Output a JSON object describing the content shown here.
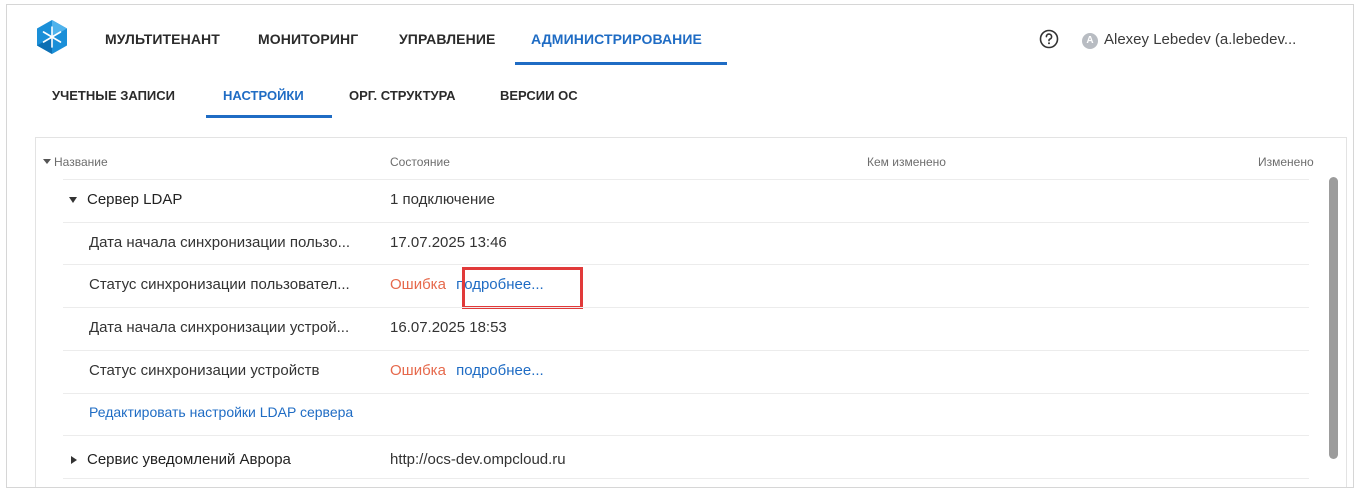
{
  "topnav": {
    "items": [
      {
        "label": "МУЛЬТИТЕНАНТ"
      },
      {
        "label": "МОНИТОРИНГ"
      },
      {
        "label": "УПРАВЛЕНИЕ"
      },
      {
        "label": "АДМИНИСТРИРОВАНИЕ"
      }
    ],
    "active_index": 3,
    "user": {
      "avatar_letter": "A",
      "name": "Alexey Lebedev (a.lebedev..."
    }
  },
  "subnav": {
    "items": [
      {
        "label": "УЧЕТНЫЕ ЗАПИСИ"
      },
      {
        "label": "НАСТРОЙКИ"
      },
      {
        "label": "ОРГ. СТРУКТУРА"
      },
      {
        "label": "ВЕРСИИ ОС"
      }
    ],
    "active_index": 1
  },
  "table": {
    "headers": {
      "name": "Название",
      "state": "Состояние",
      "changed_by": "Кем изменено",
      "changed_at": "Изменено"
    },
    "groups": [
      {
        "name": "Сервер LDAP",
        "state": "1 подключение",
        "expanded": true,
        "rows": [
          {
            "name": "Дата начала синхронизации пользо...",
            "state": "17.07.2025 13:46"
          },
          {
            "name": "Статус синхронизации пользовател...",
            "state_error": "Ошибка",
            "state_link": "подробнее..."
          },
          {
            "name": "Дата начала синхронизации устрой...",
            "state": "16.07.2025 18:53"
          },
          {
            "name": "Статус синхронизации устройств",
            "state_error": "Ошибка",
            "state_link": "подробнее..."
          }
        ],
        "edit_link": "Редактировать настройки LDAP сервера"
      },
      {
        "name": "Сервис уведомлений Аврора",
        "state": "http://ocs-dev.ompcloud.ru",
        "expanded": false
      }
    ]
  },
  "colors": {
    "accent": "#1f6cc4",
    "error": "#e6694c",
    "highlight": "#e13a3a"
  }
}
